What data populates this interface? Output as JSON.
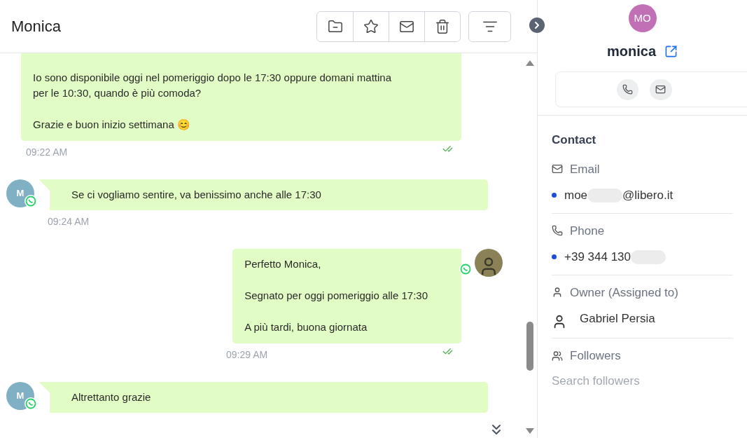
{
  "header": {
    "title": "Monica"
  },
  "messages": [
    {
      "kind": "outgoing",
      "paragraphs": [
        [
          "Io sono disponibile oggi nel pomeriggio dopo le 17:30 oppure domani mattina",
          "per le 10:30, quando è più comoda?"
        ],
        [
          "Grazie e buon inizio settimana 😊"
        ]
      ],
      "time": "09:22 AM",
      "read": true,
      "avatar": false
    },
    {
      "kind": "incoming",
      "avatar_initial": "M",
      "paragraphs": [
        [
          "Se ci vogliamo sentire, va benissimo anche alle 17:30"
        ]
      ],
      "time": "09:24 AM"
    },
    {
      "kind": "outgoing",
      "paragraphs": [
        [
          "Perfetto Monica,"
        ],
        [
          "Segnato per oggi pomeriggio alle 17:30"
        ],
        [
          "A più tardi, buona giornata"
        ]
      ],
      "time": "09:29 AM",
      "read": true,
      "avatar": true
    },
    {
      "kind": "incoming",
      "avatar_initial": "M",
      "paragraphs": [
        [
          "Altrettanto grazie"
        ]
      ]
    }
  ],
  "contact": {
    "initials": "MO",
    "name": "monica"
  },
  "section": {
    "title": "Contact",
    "fields": [
      {
        "kind": "email",
        "label": "Email",
        "value_start": "moe",
        "value_end": "@libero.it"
      },
      {
        "kind": "phone",
        "label": "Phone",
        "value_start": "+39 344 130"
      },
      {
        "kind": "owner",
        "label": "Owner (Assigned to)",
        "value_start": "Gabriel Persia"
      },
      {
        "kind": "followers",
        "label": "Followers",
        "placeholder": "Search followers"
      }
    ]
  }
}
